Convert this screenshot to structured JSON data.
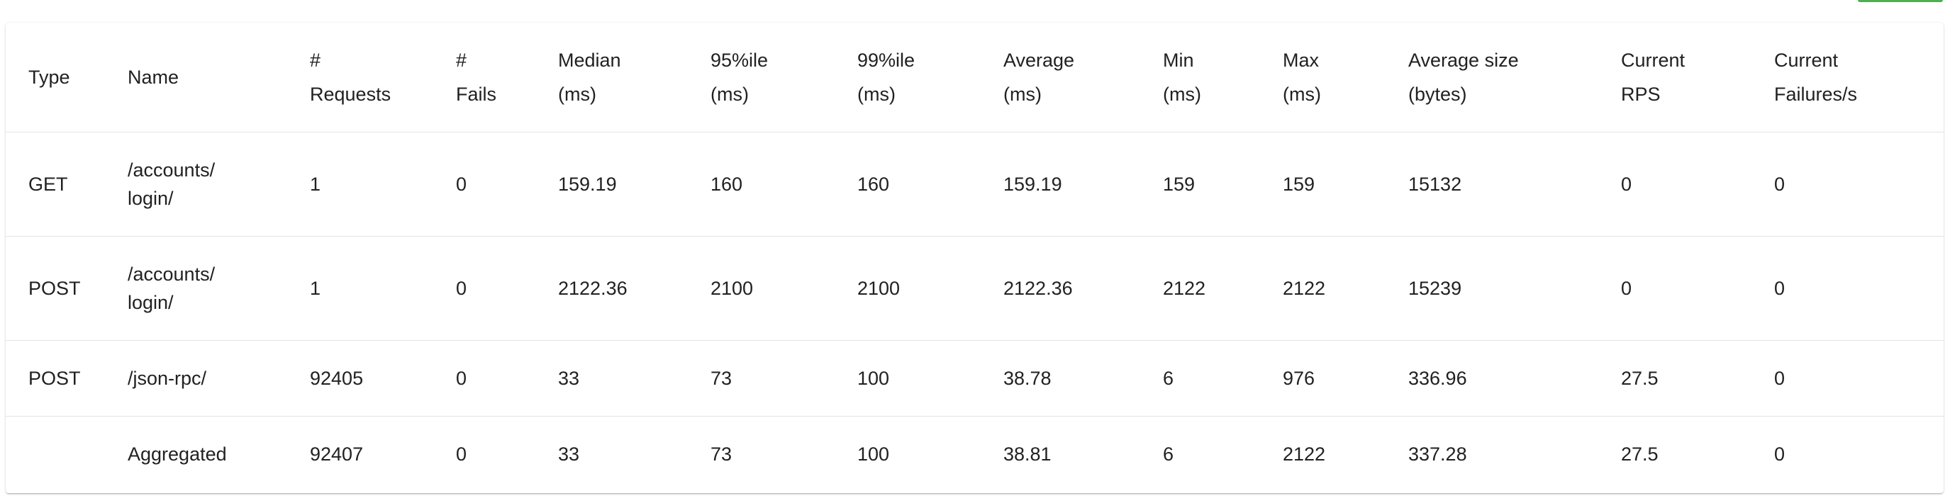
{
  "table": {
    "headers": [
      [
        "Type"
      ],
      [
        "Name"
      ],
      [
        "#",
        "Requests"
      ],
      [
        "#",
        "Fails"
      ],
      [
        "Median",
        "(ms)"
      ],
      [
        "95%ile",
        "(ms)"
      ],
      [
        "99%ile",
        "(ms)"
      ],
      [
        "Average",
        "(ms)"
      ],
      [
        "Min",
        "(ms)"
      ],
      [
        "Max",
        "(ms)"
      ],
      [
        "Average size",
        "(bytes)"
      ],
      [
        "Current",
        "RPS"
      ],
      [
        "Current",
        "Failures/s"
      ]
    ],
    "rows": [
      {
        "type": "GET",
        "name": [
          "/accounts/",
          "login/"
        ],
        "requests": "1",
        "fails": "0",
        "median": "159.19",
        "p95": "160",
        "p99": "160",
        "average": "159.19",
        "min": "159",
        "max": "159",
        "avg_size": "15132",
        "current_rps": "0",
        "current_failures": "0"
      },
      {
        "type": "POST",
        "name": [
          "/accounts/",
          "login/"
        ],
        "requests": "1",
        "fails": "0",
        "median": "2122.36",
        "p95": "2100",
        "p99": "2100",
        "average": "2122.36",
        "min": "2122",
        "max": "2122",
        "avg_size": "15239",
        "current_rps": "0",
        "current_failures": "0"
      },
      {
        "type": "POST",
        "name": [
          "/json-rpc/"
        ],
        "requests": "92405",
        "fails": "0",
        "median": "33",
        "p95": "73",
        "p99": "100",
        "average": "38.78",
        "min": "6",
        "max": "976",
        "avg_size": "336.96",
        "current_rps": "27.5",
        "current_failures": "0"
      },
      {
        "type": "",
        "name": [
          "Aggregated"
        ],
        "requests": "92407",
        "fails": "0",
        "median": "33",
        "p95": "73",
        "p99": "100",
        "average": "38.81",
        "min": "6",
        "max": "2122",
        "avg_size": "337.28",
        "current_rps": "27.5",
        "current_failures": "0"
      }
    ]
  },
  "colors": {
    "accent": "#4caf50",
    "divider": "#e3e3e3",
    "text": "#212121"
  }
}
